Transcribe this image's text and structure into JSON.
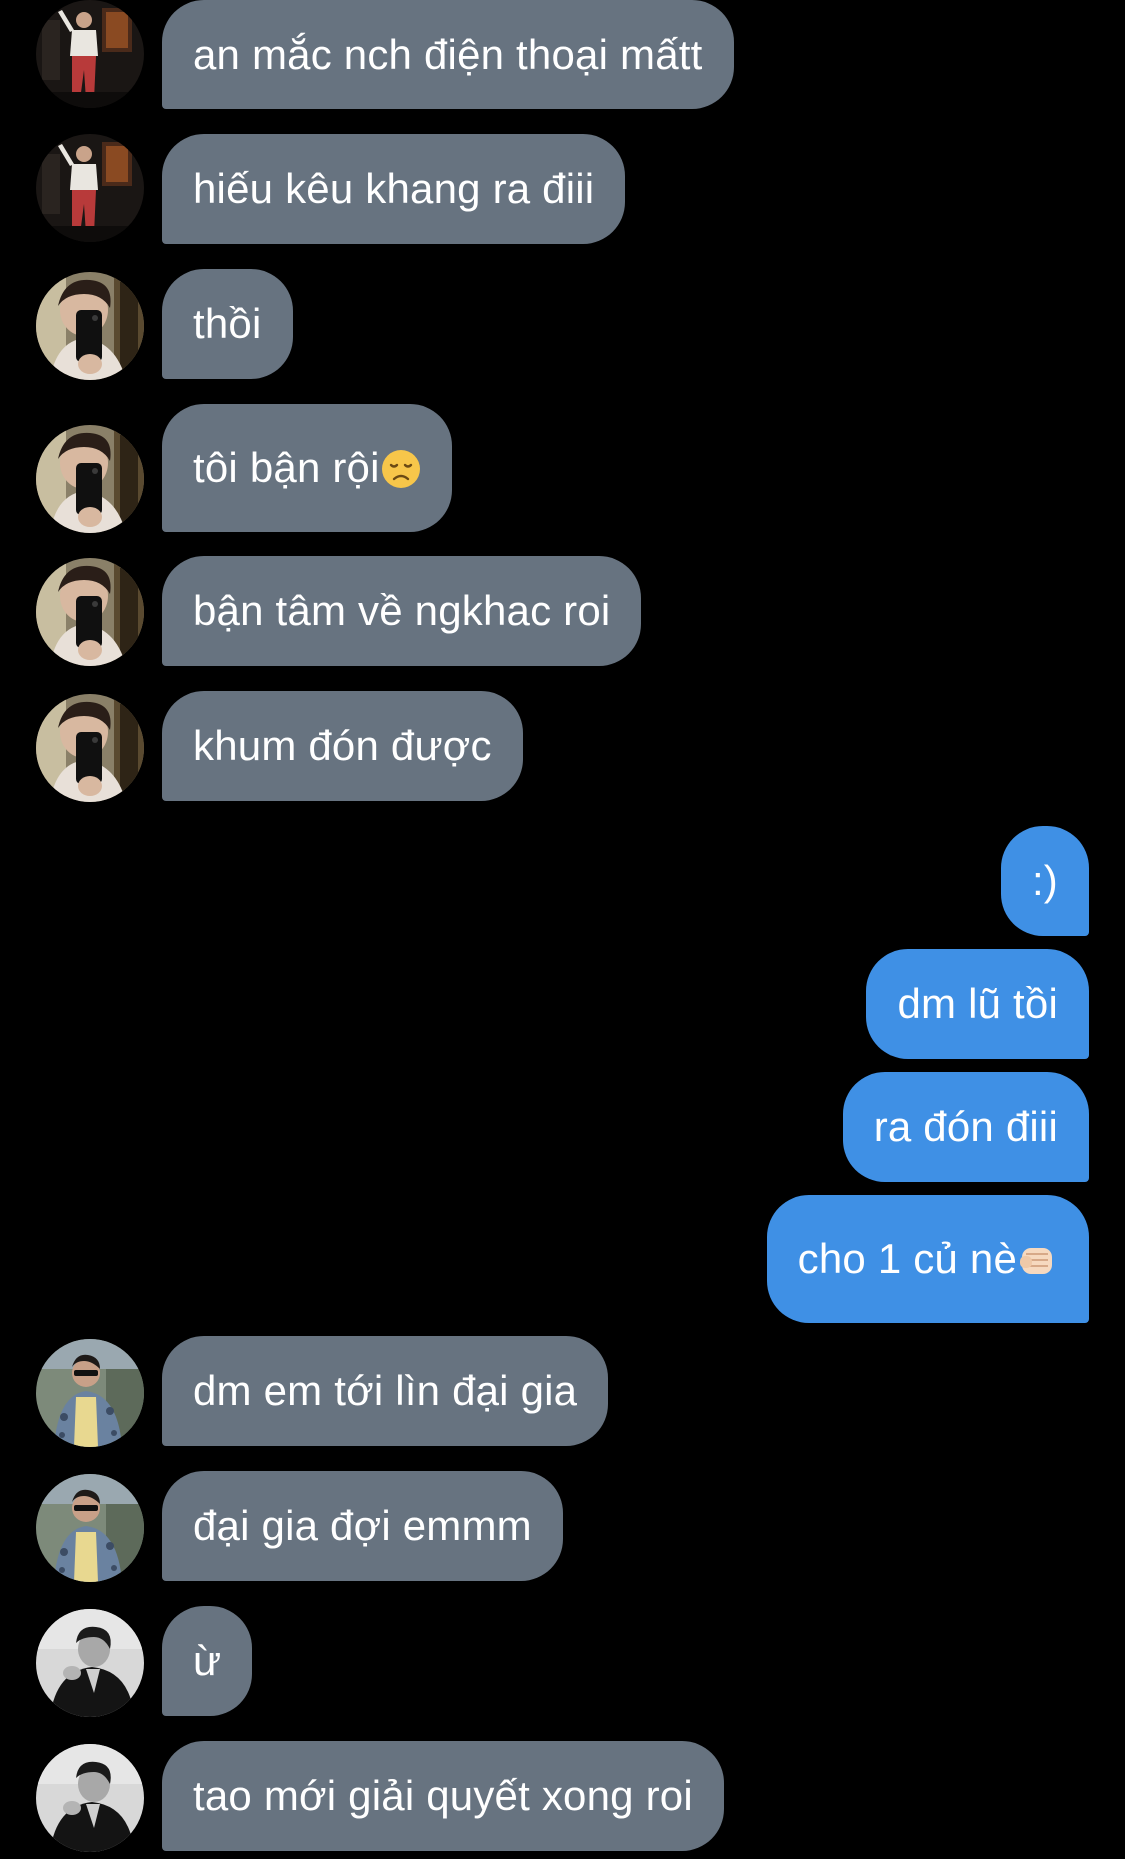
{
  "conversation": {
    "messages": [
      {
        "direction": "in",
        "sender": "user-a",
        "text": "an mắc nch điện thoại mấtt"
      },
      {
        "direction": "in",
        "sender": "user-a",
        "text": "hiếu kêu khang ra điii"
      },
      {
        "direction": "in",
        "sender": "user-b",
        "text": "thồi"
      },
      {
        "direction": "in",
        "sender": "user-b",
        "text": "tôi bận rội",
        "emoji": "disappointed-face-emoji"
      },
      {
        "direction": "in",
        "sender": "user-b",
        "text": "bận tâm về ngkhac roi"
      },
      {
        "direction": "in",
        "sender": "user-b",
        "text": "khum đón được"
      },
      {
        "direction": "out",
        "sender": "me",
        "text": ":)"
      },
      {
        "direction": "out",
        "sender": "me",
        "text": "dm lũ tồi"
      },
      {
        "direction": "out",
        "sender": "me",
        "text": "ra đón điii"
      },
      {
        "direction": "out",
        "sender": "me",
        "text": "cho 1 củ nè",
        "emoji": "oncoming-fist-emoji"
      },
      {
        "direction": "in",
        "sender": "user-c",
        "text": "dm em tới lìn đại gia"
      },
      {
        "direction": "in",
        "sender": "user-c",
        "text": "đại gia đợi emmm"
      },
      {
        "direction": "in",
        "sender": "user-d",
        "text": "ừ"
      },
      {
        "direction": "in",
        "sender": "user-d",
        "text": "tao mới giải quyết xong roi"
      }
    ]
  },
  "theme": {
    "background": "#000000",
    "incoming_bubble": "#677380",
    "outgoing_bubble": "#3f90e5",
    "text": "#ffffff"
  }
}
